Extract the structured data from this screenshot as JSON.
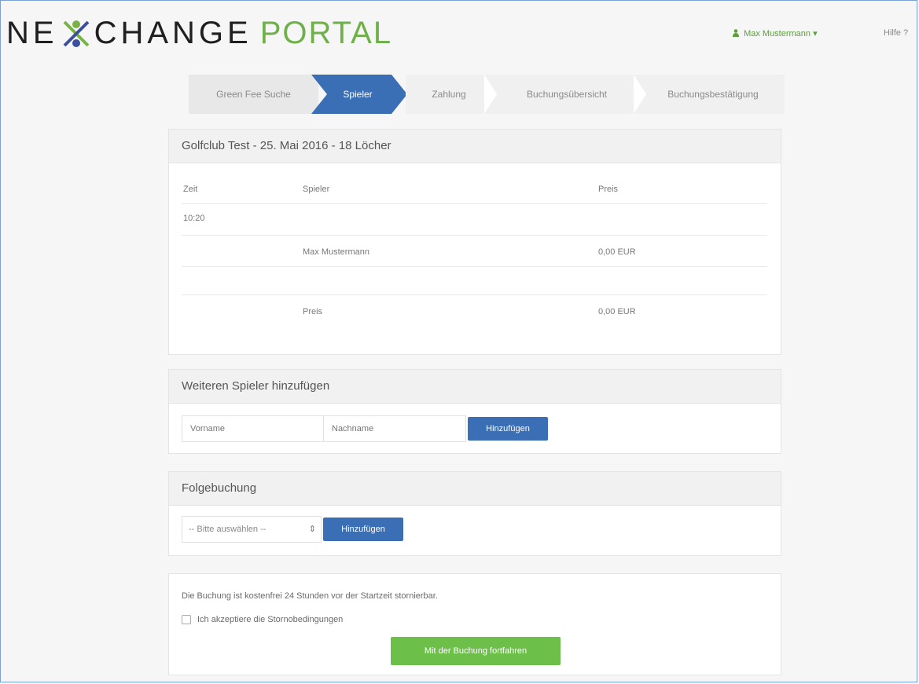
{
  "header": {
    "logo_left": "NE",
    "logo_mid": "CHANGE",
    "logo_portal": "PORTAL",
    "user_menu": "Max Mustermann ▾",
    "help_link": "Hilfe ?"
  },
  "colors": {
    "accent_blue": "#3a6fb6",
    "accent_green": "#6cc04a",
    "brand_green": "#6fb04a"
  },
  "stepper": {
    "steps": [
      "Green Fee Suche",
      "Spieler",
      "Zahlung",
      "Buchungsübersicht",
      "Buchungsbestätigung"
    ],
    "active_index": 1
  },
  "booking": {
    "title": "Golfclub Test - 25. Mai 2016 - 18 Löcher",
    "columns": {
      "time": "Zeit",
      "player": "Spieler",
      "price": "Preis"
    },
    "time_value": "10:20",
    "player_row": {
      "player": "Max Mustermann",
      "price": "0,00 EUR"
    },
    "total_row": {
      "label": "Preis",
      "price": "0,00 EUR"
    }
  },
  "add_player": {
    "title": "Weiteren Spieler hinzufügen",
    "firstname_placeholder": "Vorname",
    "lastname_placeholder": "Nachname",
    "button": "Hinzufügen"
  },
  "follow_booking": {
    "title": "Folgebuchung",
    "select_value": "-- Bitte auswählen --",
    "button": "Hinzufügen"
  },
  "confirm": {
    "note": "Die Buchung ist kostenfrei 24 Stunden vor der Startzeit stornierbar.",
    "checkbox_label": "Ich akzeptiere die Stornobedingungen",
    "button": "Mit der Buchung fortfahren"
  }
}
